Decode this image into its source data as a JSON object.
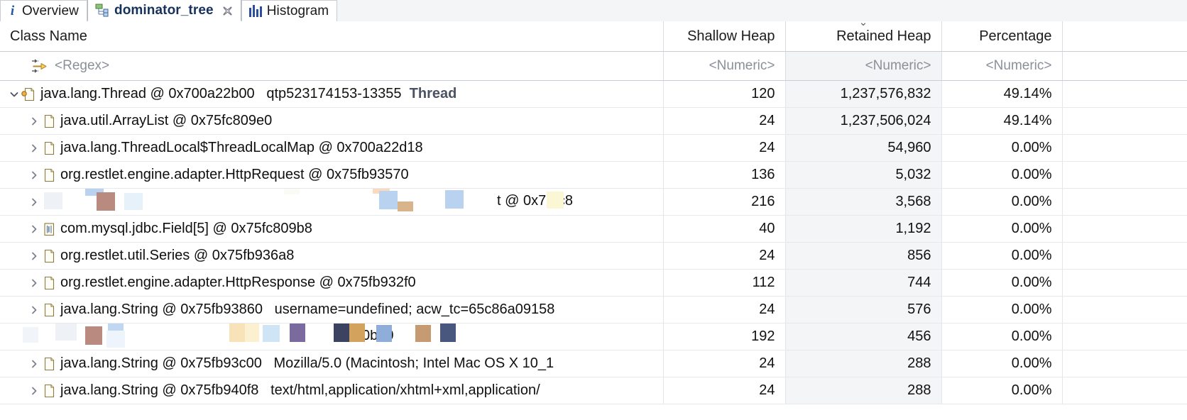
{
  "tabs": [
    {
      "label": "Overview",
      "icon": "info-icon",
      "active": false,
      "closable": false
    },
    {
      "label": "dominator_tree",
      "icon": "tree-icon",
      "active": true,
      "closable": true
    },
    {
      "label": "Histogram",
      "icon": "histogram-icon",
      "active": false,
      "closable": false
    }
  ],
  "columns": {
    "class_name": "Class Name",
    "shallow_heap": "Shallow Heap",
    "retained_heap": "Retained Heap",
    "percentage": "Percentage"
  },
  "sort": {
    "column": "retained_heap",
    "direction": "descending",
    "glyph": "⌄"
  },
  "filter": {
    "class_name": "<Regex>",
    "shallow_heap": "<Numeric>",
    "retained_heap": "<Numeric>",
    "percentage": "<Numeric>",
    "icon": "regex-filter-icon"
  },
  "rows": [
    {
      "indent": 0,
      "expander": "expanded",
      "icon": "thread-object-icon",
      "name": "java.lang.Thread @ 0x700a22b00",
      "detail": "qtp523174153-13355",
      "suffix": "Thread",
      "shallow_heap": "120",
      "retained_heap": "1,237,576,832",
      "percentage": "49.14%",
      "redacted": false
    },
    {
      "indent": 1,
      "expander": "collapsed",
      "icon": "object-icon",
      "name": "java.util.ArrayList @ 0x75fc809e0",
      "detail": "",
      "suffix": "",
      "shallow_heap": "24",
      "retained_heap": "1,237,506,024",
      "percentage": "49.14%",
      "redacted": false
    },
    {
      "indent": 1,
      "expander": "collapsed",
      "icon": "object-icon",
      "name": "java.lang.ThreadLocal$ThreadLocalMap @ 0x700a22d18",
      "detail": "",
      "suffix": "",
      "shallow_heap": "24",
      "retained_heap": "54,960",
      "percentage": "0.00%",
      "redacted": false
    },
    {
      "indent": 1,
      "expander": "collapsed",
      "icon": "object-icon",
      "name": "org.restlet.engine.adapter.HttpRequest @ 0x75fb93570",
      "detail": "",
      "suffix": "",
      "shallow_heap": "136",
      "retained_heap": "5,032",
      "percentage": "0.00%",
      "redacted": false
    },
    {
      "indent": 1,
      "expander": "collapsed",
      "icon": "object-icon",
      "name": "",
      "detail": "",
      "suffix": "",
      "tail_text": "st @ 0x75fc8",
      "shallow_heap": "216",
      "retained_heap": "3,568",
      "percentage": "0.00%",
      "redacted": true
    },
    {
      "indent": 1,
      "expander": "collapsed",
      "icon": "array-object-icon",
      "name": "com.mysql.jdbc.Field[5] @ 0x75fc809b8",
      "detail": "",
      "suffix": "",
      "shallow_heap": "40",
      "retained_heap": "1,192",
      "percentage": "0.00%",
      "redacted": false
    },
    {
      "indent": 1,
      "expander": "collapsed",
      "icon": "object-icon",
      "name": "org.restlet.util.Series @ 0x75fb936a8",
      "detail": "",
      "suffix": "",
      "shallow_heap": "24",
      "retained_heap": "856",
      "percentage": "0.00%",
      "redacted": false
    },
    {
      "indent": 1,
      "expander": "collapsed",
      "icon": "object-icon",
      "name": "org.restlet.engine.adapter.HttpResponse @ 0x75fb932f0",
      "detail": "",
      "suffix": "",
      "shallow_heap": "112",
      "retained_heap": "744",
      "percentage": "0.00%",
      "redacted": false
    },
    {
      "indent": 1,
      "expander": "collapsed",
      "icon": "object-icon",
      "name": "java.lang.String @ 0x75fb93860",
      "detail": "username=undefined; acw_tc=65c86a09158",
      "suffix": "",
      "shallow_heap": "24",
      "retained_heap": "576",
      "percentage": "0.00%",
      "redacted": false
    },
    {
      "indent": 1,
      "expander": "collapsed",
      "icon": "object-icon",
      "name": "",
      "detail": "",
      "suffix": "",
      "tail_text": "0b90",
      "shallow_heap": "192",
      "retained_heap": "456",
      "percentage": "0.00%",
      "redacted": true
    },
    {
      "indent": 1,
      "expander": "collapsed",
      "icon": "object-icon",
      "name": "java.lang.String @ 0x75fb93c00",
      "detail": "Mozilla/5.0 (Macintosh; Intel Mac OS X 10_1",
      "suffix": "",
      "shallow_heap": "24",
      "retained_heap": "288",
      "percentage": "0.00%",
      "redacted": false
    },
    {
      "indent": 1,
      "expander": "collapsed",
      "icon": "object-icon",
      "name": "java.lang.String @ 0x75fb940f8",
      "detail": "text/html,application/xhtml+xml,application/",
      "suffix": "",
      "shallow_heap": "24",
      "retained_heap": "288",
      "percentage": "0.00%",
      "redacted": false
    }
  ],
  "colors": {
    "tab_active_text": "#16325c",
    "accent_blue": "#2154a6",
    "header_text": "#1b1b1b",
    "placeholder": "#8a8f98",
    "grid_line": "#e2e5e9",
    "shade_column": "#f4f5f6"
  }
}
